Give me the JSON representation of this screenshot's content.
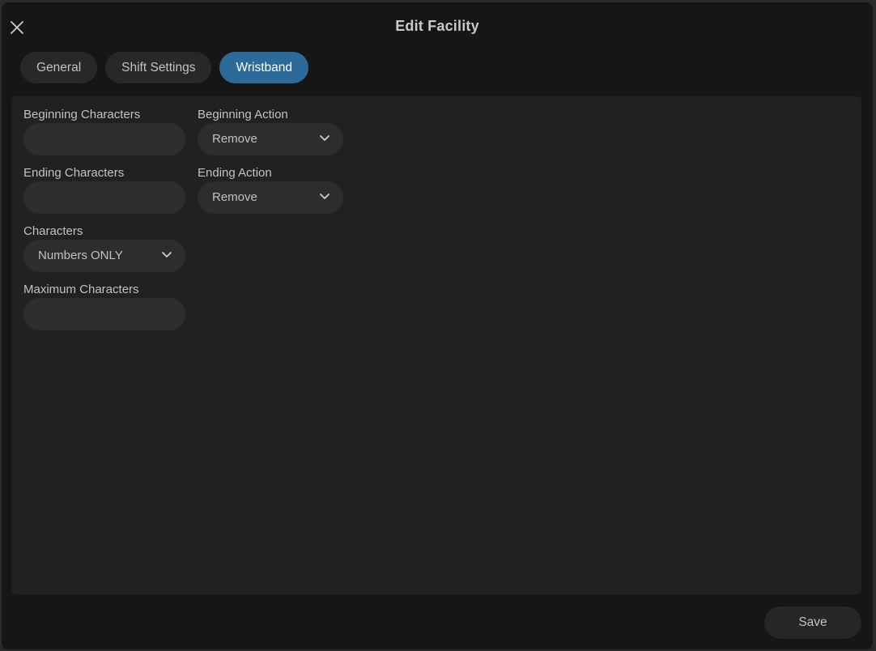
{
  "dialog": {
    "title": "Edit Facility",
    "close_icon": "close-icon"
  },
  "tabs": [
    {
      "label": "General",
      "active": false
    },
    {
      "label": "Shift Settings",
      "active": false
    },
    {
      "label": "Wristband",
      "active": true
    }
  ],
  "form": {
    "beginning_characters": {
      "label": "Beginning Characters",
      "value": ""
    },
    "beginning_action": {
      "label": "Beginning Action",
      "value": "Remove",
      "icon": "chevron-down-icon"
    },
    "ending_characters": {
      "label": "Ending Characters",
      "value": ""
    },
    "ending_action": {
      "label": "Ending Action",
      "value": "Remove",
      "icon": "chevron-down-icon"
    },
    "characters": {
      "label": "Characters",
      "value": "Numbers ONLY",
      "icon": "chevron-down-icon"
    },
    "maximum_characters": {
      "label": "Maximum Characters",
      "value": ""
    }
  },
  "footer": {
    "save_label": "Save"
  },
  "colors": {
    "accent": "#2c6a99",
    "background": "#161616",
    "panel": "#212121",
    "control": "#2d2d2d"
  }
}
